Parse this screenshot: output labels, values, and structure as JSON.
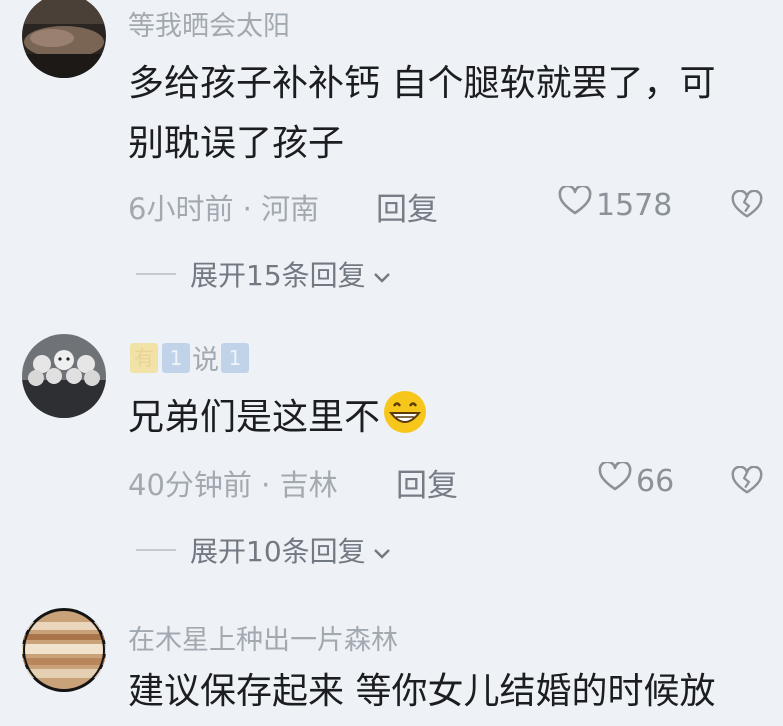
{
  "comments": [
    {
      "username": "等我晒会太阳",
      "text_line1": "多给孩子补补钙 自个腿软就罢了，可",
      "text_line2": "别耽误了孩子",
      "time": "6小时前",
      "location": "河南",
      "reply_label": "回复",
      "likes": "1578",
      "expand_label": "展开15条回复"
    },
    {
      "username_badges": [
        "有",
        "1",
        "说",
        "1"
      ],
      "text": "兄弟们是这里不",
      "emoji": "grinning-face-emoji",
      "time": "40分钟前",
      "location": "吉林",
      "reply_label": "回复",
      "likes": "66",
      "expand_label": "展开10条回复"
    },
    {
      "username": "在木星上种出一片森林",
      "text": "建议保存起来 等你女儿结婚的时候放"
    }
  ],
  "separator": "·",
  "colors": {
    "background": "#eef2f6",
    "username": "#a3a9b1",
    "text": "#1c1d20",
    "meta": "#a3a9b1"
  },
  "icons": {
    "like": "heart-outline-icon",
    "dislike": "broken-heart-icon",
    "expand": "chevron-down-icon"
  }
}
